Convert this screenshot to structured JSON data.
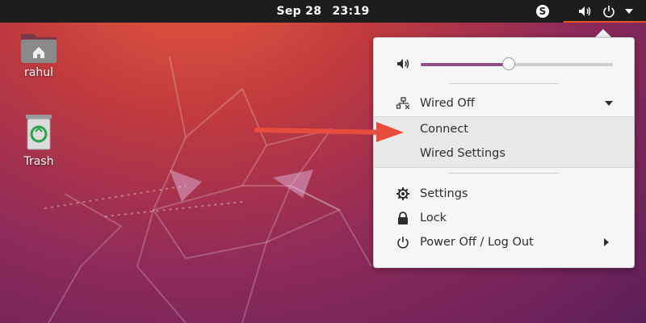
{
  "topbar": {
    "date": "Sep 28",
    "time": "23:19",
    "tray_app_letter": "S",
    "accent": "#e95420"
  },
  "desktop": {
    "icons": [
      {
        "label": "rahul",
        "icon": "home-folder-icon"
      },
      {
        "label": "Trash",
        "icon": "trash-icon"
      }
    ]
  },
  "system_menu": {
    "volume": {
      "icon": "speaker-icon",
      "level": 0.46,
      "accent": "#924d8b"
    },
    "network": {
      "icon": "wired-network-icon",
      "label": "Wired Off",
      "submenu": [
        {
          "label": "Connect"
        },
        {
          "label": "Wired Settings"
        }
      ]
    },
    "items": [
      {
        "label": "Settings",
        "icon": "gear-icon"
      },
      {
        "label": "Lock",
        "icon": "lock-icon"
      },
      {
        "label": "Power Off / Log Out",
        "icon": "power-icon"
      }
    ]
  },
  "annotation": {
    "color": "#e84c3d"
  }
}
